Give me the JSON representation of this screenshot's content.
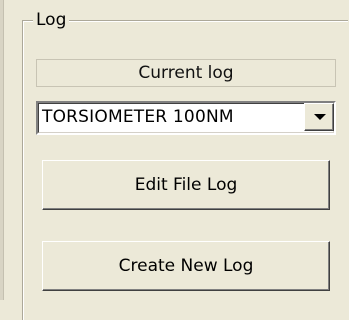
{
  "group": {
    "title": "Log"
  },
  "current_log": {
    "label": "Current log"
  },
  "log_select": {
    "value": "TORSIOMETER 100NM"
  },
  "buttons": {
    "edit": "Edit File Log",
    "create": "Create New Log"
  },
  "icons": {
    "dropdown": "chevron-down-icon"
  }
}
